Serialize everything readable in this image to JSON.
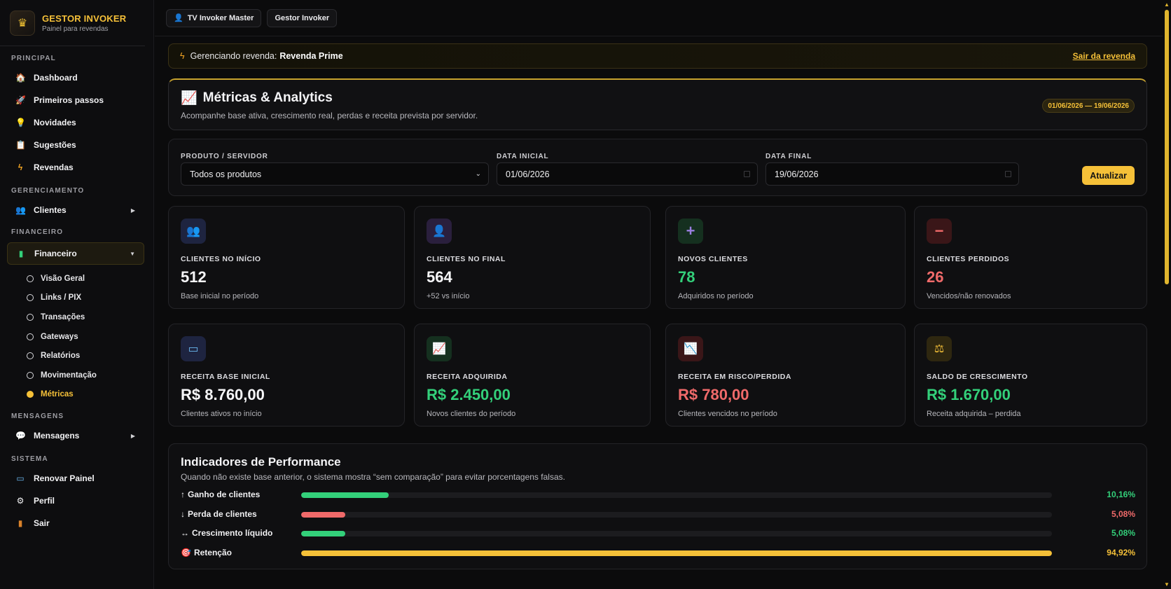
{
  "brand": {
    "title": "GESTOR INVOKER",
    "subtitle": "Painel para revendas"
  },
  "sidebar": {
    "principal": {
      "title": "PRINCIPAL",
      "items": [
        {
          "label": "Dashboard",
          "icon": "home-icon"
        },
        {
          "label": "Primeiros passos",
          "icon": "rocket-icon"
        },
        {
          "label": "Novidades",
          "icon": "bulb-icon"
        },
        {
          "label": "Sugestões",
          "icon": "clipboard-icon"
        },
        {
          "label": "Revendas",
          "icon": "bolt-icon"
        }
      ]
    },
    "gerenciamento": {
      "title": "GERENCIAMENTO",
      "items": [
        {
          "label": "Clientes",
          "icon": "users-icon"
        }
      ]
    },
    "financeiro": {
      "title": "FINANCEIRO",
      "label": "Financeiro",
      "subitems": [
        "Visão Geral",
        "Links / PIX",
        "Transações",
        "Gateways",
        "Relatórios",
        "Movimentação",
        "Métricas"
      ],
      "active": "Métricas"
    },
    "mensagens": {
      "title": "MENSAGENS",
      "label": "Mensagens"
    },
    "sistema": {
      "title": "SISTEMA",
      "items": [
        {
          "label": "Renovar Painel",
          "icon": "card-icon"
        },
        {
          "label": "Perfil",
          "icon": "gear-icon"
        },
        {
          "label": "Sair",
          "icon": "door-icon"
        }
      ]
    }
  },
  "topbar": {
    "chips": [
      "TV Invoker Master",
      "Gestor Invoker"
    ]
  },
  "banner": {
    "prefix": "Gerenciando revenda:",
    "name": "Revenda Prime",
    "exit": "Sair da revenda"
  },
  "header": {
    "title": "Métricas & Analytics",
    "subtitle": "Acompanhe base ativa, crescimento real, perdas e receita prevista por servidor.",
    "date_range": "01/06/2026 — 19/06/2026"
  },
  "filters": {
    "product_label": "PRODUTO / SERVIDOR",
    "product_value": "Todos os produtos",
    "start_label": "DATA INICIAL",
    "start_value": "01/06/2026",
    "end_label": "DATA FINAL",
    "end_value": "19/06/2026",
    "button": "Atualizar"
  },
  "cards": [
    {
      "label": "CLIENTES NO INÍCIO",
      "value": "512",
      "hint": "Base inicial no período",
      "icon": "users-icon",
      "tone": "neutral"
    },
    {
      "label": "CLIENTES NO FINAL",
      "value": "564",
      "hint": "+52 vs início",
      "icon": "user-icon",
      "tone": "neutral"
    },
    {
      "label": "NOVOS CLIENTES",
      "value": "78",
      "hint": "Adquiridos no período",
      "icon": "plus-icon",
      "tone": "green"
    },
    {
      "label": "CLIENTES PERDIDOS",
      "value": "26",
      "hint": "Vencidos/não renovados",
      "icon": "minus-icon",
      "tone": "red"
    },
    {
      "label": "RECEITA BASE INICIAL",
      "value": "R$ 8.760,00",
      "hint": "Clientes ativos no início",
      "icon": "card-icon",
      "tone": "neutral"
    },
    {
      "label": "RECEITA ADQUIRIDA",
      "value": "R$ 2.450,00",
      "hint": "Novos clientes do período",
      "icon": "chart-up-icon",
      "tone": "green"
    },
    {
      "label": "RECEITA EM RISCO/PERDIDA",
      "value": "R$ 780,00",
      "hint": "Clientes vencidos no período",
      "icon": "chart-down-icon",
      "tone": "red"
    },
    {
      "label": "SALDO DE CRESCIMENTO",
      "value": "R$ 1.670,00",
      "hint": "Receita adquirida – perdida",
      "icon": "scale-icon",
      "tone": "green"
    }
  ],
  "performance": {
    "title": "Indicadores de Performance",
    "subtitle": "Quando não existe base anterior, o sistema mostra “sem comparação” para evitar porcentagens falsas.",
    "rows": [
      {
        "glyph": "↑",
        "label": "Ganho de clientes",
        "percent": 10.16,
        "display": "10,16%",
        "color": "#33d07a"
      },
      {
        "glyph": "↓",
        "label": "Perda de clientes",
        "percent": 5.08,
        "display": "5,08%",
        "color": "#f06a6a"
      },
      {
        "glyph": "↔",
        "label": "Crescimento líquido",
        "percent": 5.08,
        "display": "5,08%",
        "color": "#33d07a"
      },
      {
        "glyph": "🎯",
        "label": "Retenção",
        "percent": 94.92,
        "display": "94,92%",
        "color": "#f5c038"
      }
    ]
  }
}
